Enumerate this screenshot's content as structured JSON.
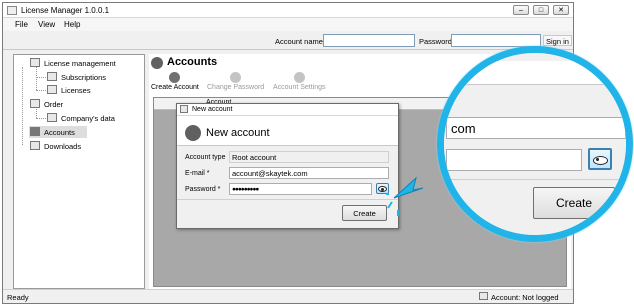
{
  "window": {
    "title": "License Manager 1.0.0.1"
  },
  "menu": {
    "file": "File",
    "view": "View",
    "help": "Help"
  },
  "topbar": {
    "account_label": "Account name",
    "password_label": "Password",
    "signin_label": "Sign in"
  },
  "tree": {
    "license_management": "License management",
    "subscriptions": "Subscriptions",
    "licenses": "Licenses",
    "order": "Order",
    "company_data": "Company's data",
    "accounts": "Accounts",
    "downloads": "Downloads"
  },
  "accounts_page": {
    "title": "Accounts",
    "create_account": "Create Account",
    "change_password": "Change Password",
    "account_settings": "Account Settings",
    "grid_header_account": "Account"
  },
  "dialog": {
    "title": "New account",
    "heading": "New account",
    "account_type_label": "Account type",
    "account_type_value": "Root account",
    "email_label": "E-mail *",
    "email_value": "account@skaytek.com",
    "password_label": "Password *",
    "password_value": "●●●●●●●●●",
    "create_label": "Create"
  },
  "status": {
    "ready": "Ready",
    "account_status": "Account: Not logged"
  },
  "zoom": {
    "email_fragment": "com",
    "create_label": "Create"
  },
  "colors": {
    "accent": "#21b4e8",
    "grid_bg": "#a8a8a8"
  }
}
